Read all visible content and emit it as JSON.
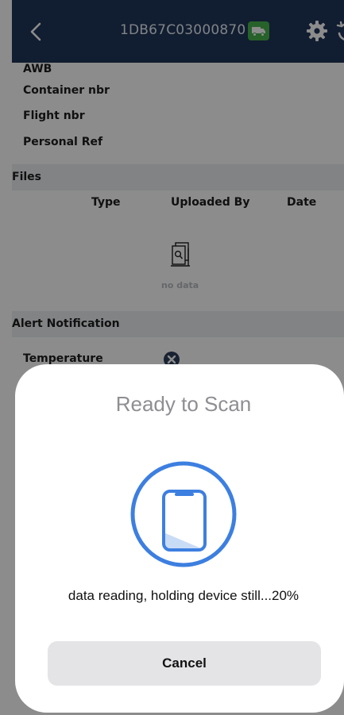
{
  "header": {
    "device_id": "1DB67C03000870"
  },
  "details": {
    "awb_label": "AWB",
    "container_label": "Container nbr",
    "flight_label": "Flight nbr",
    "personal_ref_label": "Personal Ref"
  },
  "files": {
    "section_title": "Files",
    "columns": [
      "Type",
      "Uploaded By",
      "Date"
    ],
    "empty_text": "no data"
  },
  "alerts": {
    "section_title": "Alert Notification",
    "temperature_label": "Temperature"
  },
  "scan_sheet": {
    "title": "Ready to Scan",
    "status": "data reading, holding device still...20%",
    "progress_percent": 20,
    "cancel_label": "Cancel"
  },
  "colors": {
    "header_bg": "#1f3658",
    "accent_blue": "#3d7fe0",
    "truck_badge": "#48b24d",
    "section_bar": "#eceef1"
  },
  "icons": {
    "back": "chevron-left-icon",
    "truck": "truck-icon",
    "settings": "gear-icon",
    "history": "history-icon",
    "empty": "document-search-icon",
    "alert_off": "close-circle-icon",
    "scan": "phone-scan-icon"
  }
}
